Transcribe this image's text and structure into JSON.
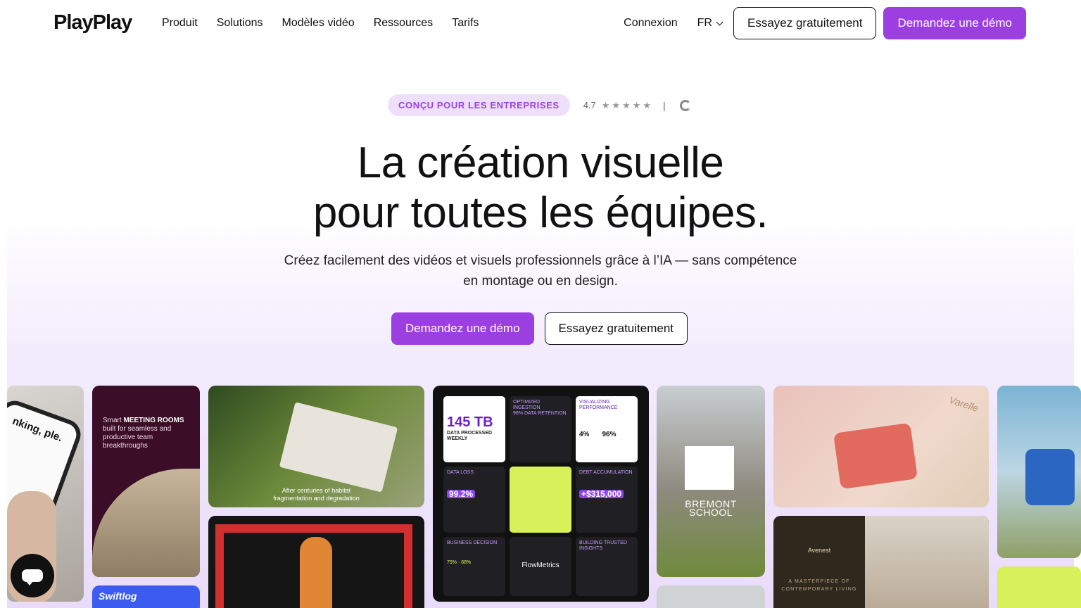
{
  "brand": {
    "logo": "PlayPlay",
    "accent": "#9b3fe0"
  },
  "nav": {
    "links": [
      "Produit",
      "Solutions",
      "Modèles vidéo",
      "Ressources",
      "Tarifs"
    ],
    "login": "Connexion",
    "language": "FR",
    "try_free": "Essayez gratuitement",
    "demo": "Demandez une démo"
  },
  "hero": {
    "badge": "CONÇU POUR LES ENTREPRISES",
    "rating": "4.7",
    "stars": "★★★★★",
    "separator": "|",
    "title_line1": "La création visuelle",
    "title_line2": "pour toutes les équipes.",
    "subtitle_line1": "Créez facilement des vidéos et visuels professionnels grâce à l’IA — sans compétence",
    "subtitle_line2": "en montage ou en design.",
    "cta_demo": "Demandez une démo",
    "cta_try": "Essayez gratuitement"
  },
  "gallery": {
    "phone_text": "nking, ple.",
    "meeting_prefix": "Smart ",
    "meeting_bold": "MEETING ROOMS",
    "meeting_rest": "built for seamless and productive team breakthroughs",
    "swift": "Swiftlog",
    "map_caption_1": "After centuries of habitat",
    "map_caption_2": "fragmentation and degradation",
    "flow_big": "145 TB",
    "flow_big_label": "DATA PROCESSED WEEKLY",
    "flow_ingestion": "OPTIMIZED INGESTION",
    "flow_retention": "98% DATA RETENTION",
    "flow_perf": "VISUALIZING PERFORMANCE",
    "flow_pct1": "4%",
    "flow_pct2": "96%",
    "flow_loss": "DATA LOSS",
    "flow_loss_val": "99.2%",
    "flow_debt": "DEBT ACCUMULATION",
    "flow_debt_val": "+$315,000",
    "flow_decision": "BUSINESS DECISION",
    "flow_decision_vals": "75% · 68%",
    "flow_logo": "FlowMetrics",
    "flow_trusted": "BUILDING TRUSTED INSIGHTS",
    "bremont_1": "BREMONT",
    "bremont_2": "SCHOOL",
    "bag_brand": "Varelle",
    "avenest": "Avenest",
    "avenest_tag_1": "A MASTERPIECE OF",
    "avenest_tag_2": "CONTEMPORARY LIVING"
  }
}
